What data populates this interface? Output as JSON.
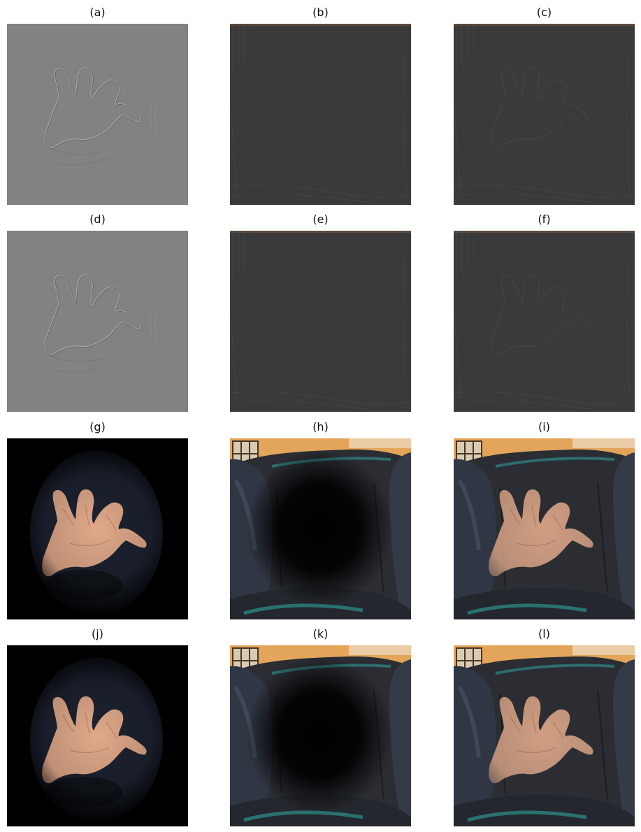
{
  "figure": {
    "panels": [
      {
        "label": "(a)",
        "kind": "edge-gray"
      },
      {
        "label": "(b)",
        "kind": "edge-dark"
      },
      {
        "label": "(c)",
        "kind": "edge-dark-hand"
      },
      {
        "label": "(d)",
        "kind": "edge-gray"
      },
      {
        "label": "(e)",
        "kind": "edge-dark"
      },
      {
        "label": "(f)",
        "kind": "edge-dark-hand"
      },
      {
        "label": "(g)",
        "kind": "hand-vignette"
      },
      {
        "label": "(h)",
        "kind": "chair-hole"
      },
      {
        "label": "(i)",
        "kind": "chair-with-hand"
      },
      {
        "label": "(j)",
        "kind": "hand-vignette"
      },
      {
        "label": "(k)",
        "kind": "chair-hole"
      },
      {
        "label": "(l)",
        "kind": "chair-with-hand"
      }
    ],
    "colors": {
      "edge_gray": "#828282",
      "edge_dark": "#3a3a3a",
      "leather": "#2b2d33",
      "leather_highlight": "#4a5566",
      "wall": "#e3a55a",
      "skin": "#e0a98a",
      "teal": "#2fa3a0"
    }
  }
}
